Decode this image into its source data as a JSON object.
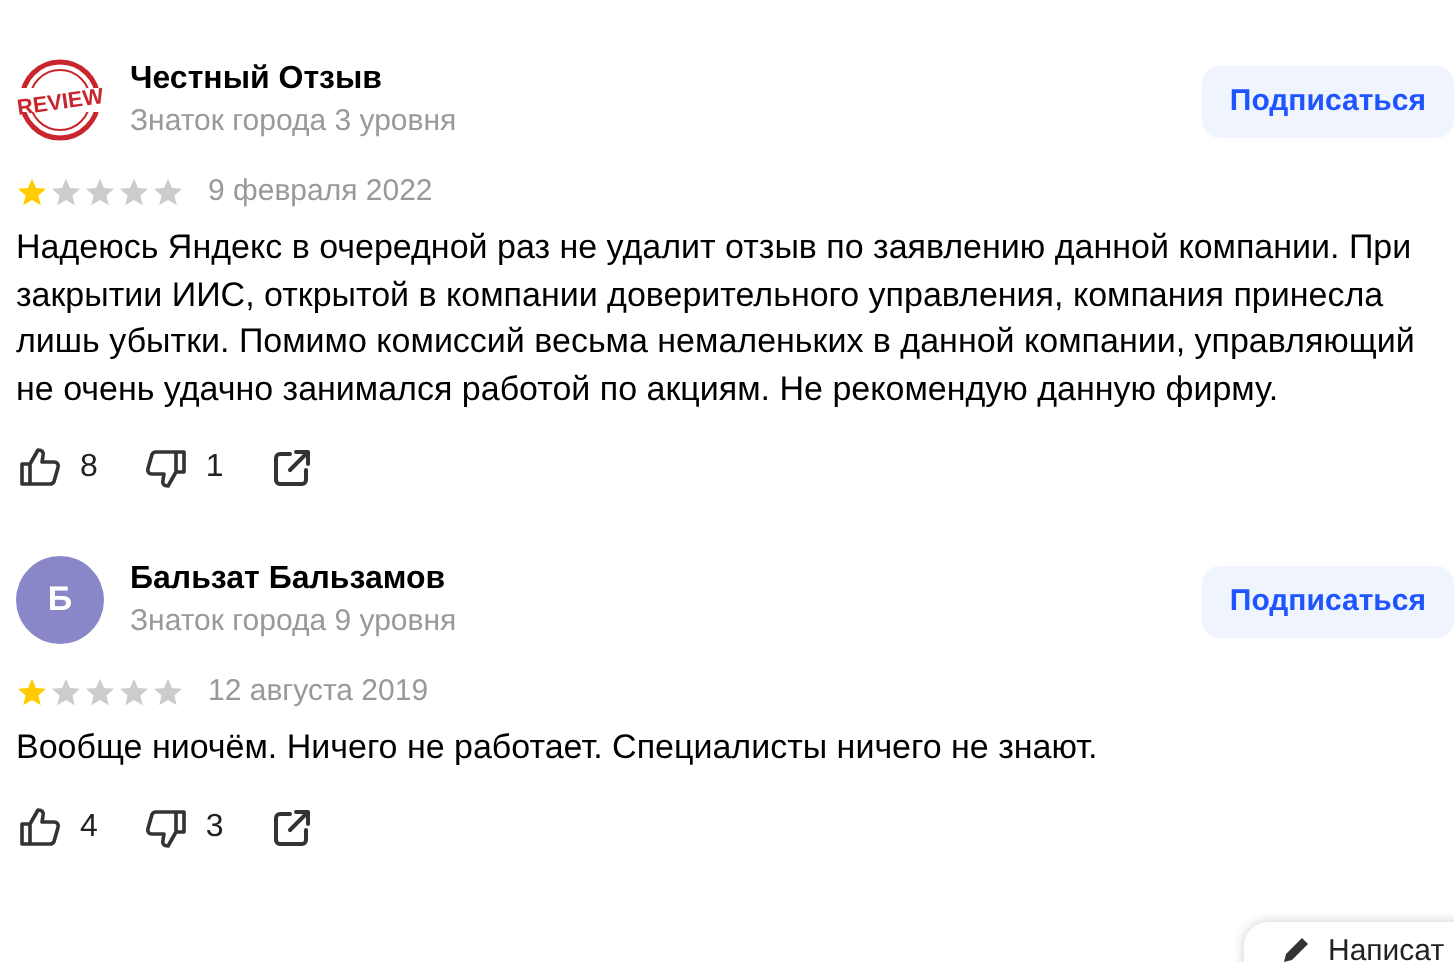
{
  "reviews": [
    {
      "author": "Честный Отзыв",
      "level": "Знаток города 3 уровня",
      "avatar": {
        "kind": "stamp",
        "text": "REVIEW"
      },
      "subscribe": "Подписаться",
      "stars": 1,
      "date": "9 февраля 2022",
      "text": "Надеюсь Яндекс в очередной раз не удалит отзыв по заявлению данной компании. При закрытии ИИС, открытой в компании доверительного управления, компания принесла лишь убытки. Помимо комиссий весьма немаленьких в данной компании, управляющий не очень удачно занимался работой по акциям. Не рекомендую данную фирму.",
      "likes": "8",
      "dislikes": "1"
    },
    {
      "author": "Бальзат Бальзамов",
      "level": "Знаток города 9 уровня",
      "avatar": {
        "kind": "letter",
        "text": "Б",
        "color": "#8a87c9"
      },
      "subscribe": "Подписаться",
      "stars": 1,
      "date": "12 августа 2019",
      "text": "Вообще ниочём. Ничего не работает. Специалисты ничего не знают.",
      "likes": "4",
      "dislikes": "3"
    }
  ],
  "write_button": "Написат"
}
